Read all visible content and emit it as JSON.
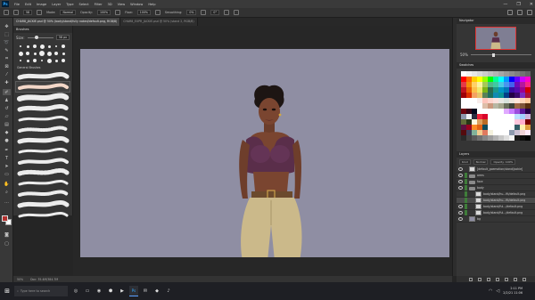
{
  "menubar": {
    "logo": "Ps",
    "items": [
      "File",
      "Edit",
      "Image",
      "Layer",
      "Type",
      "Select",
      "Filter",
      "3D",
      "View",
      "Window",
      "Help"
    ],
    "window_controls": [
      "—",
      "❐",
      "✕"
    ]
  },
  "options_bar": {
    "brush_size": "58",
    "mode_label": "Mode:",
    "mode_value": "Normal",
    "opacity_label": "Opacity:",
    "opacity_value": "100%",
    "flow_label": "Flow:",
    "flow_value": "100%",
    "smoothing_label": "Smoothing:",
    "smoothing_value": "0%",
    "angle_value": "0°"
  },
  "tabs": [
    {
      "label": "CHAR8_JACKIE.psd @ 50% (body/stand/fully naked/default.png, RGB/8)",
      "active": true
    },
    {
      "label": "CHAR8_EXPR_JACKIE.psd @ 50% (stand 2, RGB/8)",
      "active": false
    }
  ],
  "brush_panel": {
    "title": "Brushes",
    "size_label": "Size:",
    "size_value": "58 px",
    "folder_label": "General Brushes",
    "presets": [
      [
        2,
        3,
        4,
        5,
        3,
        2,
        4
      ],
      [
        5,
        4,
        3,
        6,
        5,
        4,
        3
      ],
      [
        2,
        3,
        4,
        2,
        5,
        3,
        4
      ]
    ]
  },
  "status_bar": {
    "zoom": "50%",
    "doc_info": "Doc: 35.4M/384.7M"
  },
  "navigator": {
    "title": "Navigator",
    "zoom": "50%"
  },
  "swatches": {
    "title": "Swatches",
    "colors": [
      "#ffffff",
      "#f2f2f2",
      "#e6e6e6",
      "#d9d9d9",
      "#cccccc",
      "#bfbfbf",
      "#b3b3b3",
      "#a6a6a6",
      "#999999",
      "#8c8c8c",
      "#808080",
      "#737373",
      "#666666",
      "#ff0000",
      "#ff6600",
      "#ffcc00",
      "#ffff00",
      "#99ff00",
      "#00ff00",
      "#00ff99",
      "#00ffff",
      "#0099ff",
      "#0000ff",
      "#6600ff",
      "#cc00ff",
      "#ff00cc",
      "#e63946",
      "#f48c06",
      "#ffd166",
      "#faf3a0",
      "#a7c957",
      "#52b788",
      "#40c9a2",
      "#48cae4",
      "#4895ef",
      "#4361ee",
      "#7209b7",
      "#b5179e",
      "#f72585",
      "#c1121f",
      "#e85d04",
      "#fcbf49",
      "#f1e86b",
      "#7cb518",
      "#2d6a4f",
      "#1b998b",
      "#0096c7",
      "#0077b6",
      "#3a0ca3",
      "#560bad",
      "#9d0191",
      "#d00000",
      "#9d0208",
      "#dc2f02",
      "#f4a261",
      "#e9c46a",
      "#588157",
      "#1e6f5c",
      "#118ab2",
      "#0a9396",
      "#023e8a",
      "#240046",
      "#3c096c",
      "#7b2cbf",
      "#a4133c",
      "#ffffff",
      "#ffffff",
      "#ffffff",
      "#f8edeb",
      "#fec5bb",
      "#fcd5ce",
      "#fae1dd",
      "#e8e8e4",
      "#d8e2dc",
      "#ece4db",
      "#ffe5d9",
      "#ffd7ba",
      "#fec89a",
      "#ffffff",
      "#ffffff",
      "#ffffff",
      "#ffffff",
      "#ddbea9",
      "#cb997e",
      "#b7b7a4",
      "#a5a58d",
      "#6b705c",
      "#3f4238",
      "#9c6644",
      "#7f5539",
      "#582f0e",
      "#6a040f",
      "#370617",
      "#03071e",
      "#ffffff",
      "#ffffff",
      "#ffffff",
      "#ffffff",
      "#ffffff",
      "#e0aaff",
      "#c77dff",
      "#9d4edd",
      "#5a189a",
      "#240046",
      "#8d99ae",
      "#edf2f4",
      "#2b2d42",
      "#ef233c",
      "#d90429",
      "#ffffff",
      "#ffffff",
      "#ffffff",
      "#ffffff",
      "#ffffff",
      "#bde0fe",
      "#a2d2ff",
      "#cdb4db",
      "#606c38",
      "#283618",
      "#fefae0",
      "#dda15e",
      "#bc6c25",
      "#ffffff",
      "#ffffff",
      "#ffffff",
      "#ffffff",
      "#ffffff",
      "#ffc8dd",
      "#ffafcc",
      "#780000",
      "#5f0f40",
      "#9a031e",
      "#fb8b24",
      "#e36414",
      "#0f4c5c",
      "#ffffff",
      "#ffffff",
      "#ffffff",
      "#ffffff",
      "#ffffff",
      "#335c67",
      "#fff3b0",
      "#e09f3e",
      "#540b0e",
      "#3d405b",
      "#81b29a",
      "#f2cc8f",
      "#e07a5f",
      "#f4f1de",
      "#ffffff",
      "#ffffff",
      "#ffffff",
      "#8e9aaf",
      "#cbc0d3",
      "#efd3d7",
      "#feeafa",
      "#2a2a2a",
      "#444444",
      "#5a5a5a",
      "#707070",
      "#868686",
      "#9c9c9c",
      "#b2b2b2",
      "#c8c8c8",
      "#dedede",
      "#f4f4f4",
      "#1a1a1a",
      "#0d0d0d",
      "#000000"
    ]
  },
  "layers": {
    "title": "Layers",
    "kind_label": "Kind",
    "blend_mode": "Normal",
    "opacity_label": "Opacity: 100%",
    "rows": [
      {
        "name": "[default_goemotion/stand/jackie]",
        "visible": true,
        "group": false,
        "tag": false,
        "selected": false,
        "indent": 0
      },
      {
        "name": "arms",
        "visible": true,
        "group": true,
        "tag": true,
        "selected": false,
        "indent": 0
      },
      {
        "name": "face",
        "visible": true,
        "group": true,
        "tag": true,
        "selected": false,
        "indent": 0
      },
      {
        "name": "body",
        "visible": true,
        "group": true,
        "tag": true,
        "selected": false,
        "indent": 0
      },
      {
        "name": "body/stand/hu...fit/default.png",
        "visible": false,
        "group": false,
        "tag": true,
        "selected": false,
        "indent": 1
      },
      {
        "name": "body/stand/hu...fit/default.png",
        "visible": false,
        "group": false,
        "tag": true,
        "selected": true,
        "indent": 1
      },
      {
        "name": "body/stand/ful.../default.png",
        "visible": true,
        "group": false,
        "tag": true,
        "selected": false,
        "indent": 1
      },
      {
        "name": "body/stand/ful.../default.png",
        "visible": true,
        "group": false,
        "tag": true,
        "selected": false,
        "indent": 1
      },
      {
        "name": "bg",
        "visible": true,
        "group": false,
        "tag": false,
        "selected": false,
        "indent": 0
      }
    ]
  },
  "taskbar": {
    "start": "⊞",
    "search_placeholder": "Type here to search",
    "apps": [
      "◎",
      "▭",
      "◉",
      "⬢",
      "▶",
      "Ps",
      "✉",
      "◆",
      "♪"
    ],
    "time": "2:11 PM",
    "date": "2/2/21 11:06"
  }
}
